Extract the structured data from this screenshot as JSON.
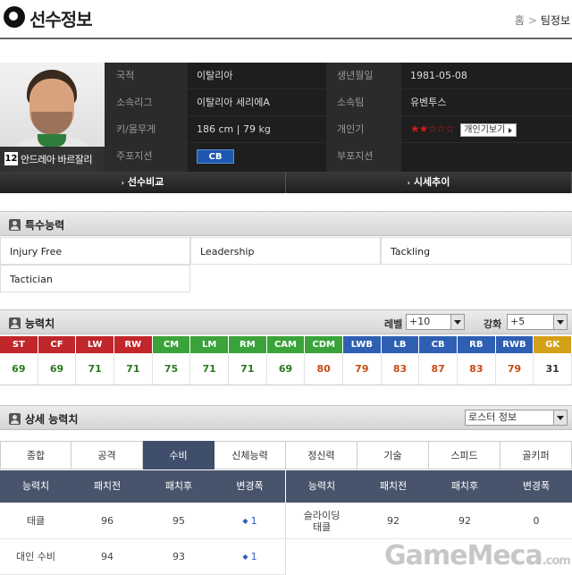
{
  "header": {
    "title": "선수정보",
    "breadcrumb": [
      "홈",
      "팀정보"
    ],
    "breadcrumb_sep": ">"
  },
  "player": {
    "back_number": "12",
    "name": "안드레아 바르잘리",
    "rows": [
      {
        "label1": "국적",
        "value1": "이탈리아",
        "label2": "생년월일",
        "value2": "1981-05-08"
      },
      {
        "label1": "소속리그",
        "value1": "이탈리아 세리에A",
        "label2": "소속팀",
        "value2": "유벤투스"
      },
      {
        "label1": "키/몸무게",
        "value1": "186 cm | 79 kg",
        "label2": "개인기",
        "value2": ""
      },
      {
        "label1": "주포지션",
        "value1": "",
        "label2": "부포지션",
        "value2": ""
      }
    ],
    "main_position": "CB",
    "skill_stars": "★★☆☆☆",
    "skill_rating": 2,
    "skill_button": "개인기보기"
  },
  "actions": {
    "compare": "선수비교",
    "market": "시세추이"
  },
  "special": {
    "title": "특수능력",
    "items": [
      "Injury Free",
      "Leadership",
      "Tackling",
      "Tactician"
    ]
  },
  "stats": {
    "title": "능력치",
    "level_label": "레벨",
    "level_value": "+10",
    "enhance_label": "강화",
    "enhance_value": "+5",
    "positions": [
      {
        "pos": "ST",
        "value": "69",
        "color": "#c0262a",
        "vcolor": "#2a7a1e"
      },
      {
        "pos": "CF",
        "value": "69",
        "color": "#c0262a",
        "vcolor": "#2a7a1e"
      },
      {
        "pos": "LW",
        "value": "71",
        "color": "#c0262a",
        "vcolor": "#2a7a1e"
      },
      {
        "pos": "RW",
        "value": "71",
        "color": "#c0262a",
        "vcolor": "#2a7a1e"
      },
      {
        "pos": "CM",
        "value": "75",
        "color": "#3aa33a",
        "vcolor": "#2a7a1e"
      },
      {
        "pos": "LM",
        "value": "71",
        "color": "#3aa33a",
        "vcolor": "#2a7a1e"
      },
      {
        "pos": "RM",
        "value": "71",
        "color": "#3aa33a",
        "vcolor": "#2a7a1e"
      },
      {
        "pos": "CAM",
        "value": "69",
        "color": "#3aa33a",
        "vcolor": "#2a7a1e"
      },
      {
        "pos": "CDM",
        "value": "80",
        "color": "#3aa33a",
        "vcolor": "#c84a12"
      },
      {
        "pos": "LWB",
        "value": "79",
        "color": "#2e5fb3",
        "vcolor": "#c84a12"
      },
      {
        "pos": "LB",
        "value": "83",
        "color": "#2e5fb3",
        "vcolor": "#c84a12"
      },
      {
        "pos": "CB",
        "value": "87",
        "color": "#2e5fb3",
        "vcolor": "#c84a12"
      },
      {
        "pos": "RB",
        "value": "83",
        "color": "#2e5fb3",
        "vcolor": "#c84a12"
      },
      {
        "pos": "RWB",
        "value": "79",
        "color": "#2e5fb3",
        "vcolor": "#c84a12"
      },
      {
        "pos": "GK",
        "value": "31",
        "color": "#d4a017",
        "vcolor": "#333333"
      }
    ]
  },
  "detail": {
    "title": "상세 능력치",
    "roster_select": "로스터 정보",
    "tabs": [
      "종합",
      "공격",
      "수비",
      "신체능력",
      "정신력",
      "기술",
      "스피드",
      "골키퍼"
    ],
    "active_tab": 2,
    "columns": [
      "능력치",
      "패치전",
      "패치후",
      "변경폭"
    ],
    "left_rows": [
      {
        "name": "태클",
        "before": "96",
        "after": "95",
        "change": "1",
        "change_icon": "diamond-icon"
      },
      {
        "name": "대인 수비",
        "before": "94",
        "after": "93",
        "change": "1",
        "change_icon": "diamond-icon"
      }
    ],
    "right_rows": [
      {
        "name": "슬라이딩\n태클",
        "before": "92",
        "after": "92",
        "change": "0"
      }
    ]
  },
  "watermark": {
    "main": "GameMeca",
    "suffix": ".com"
  }
}
